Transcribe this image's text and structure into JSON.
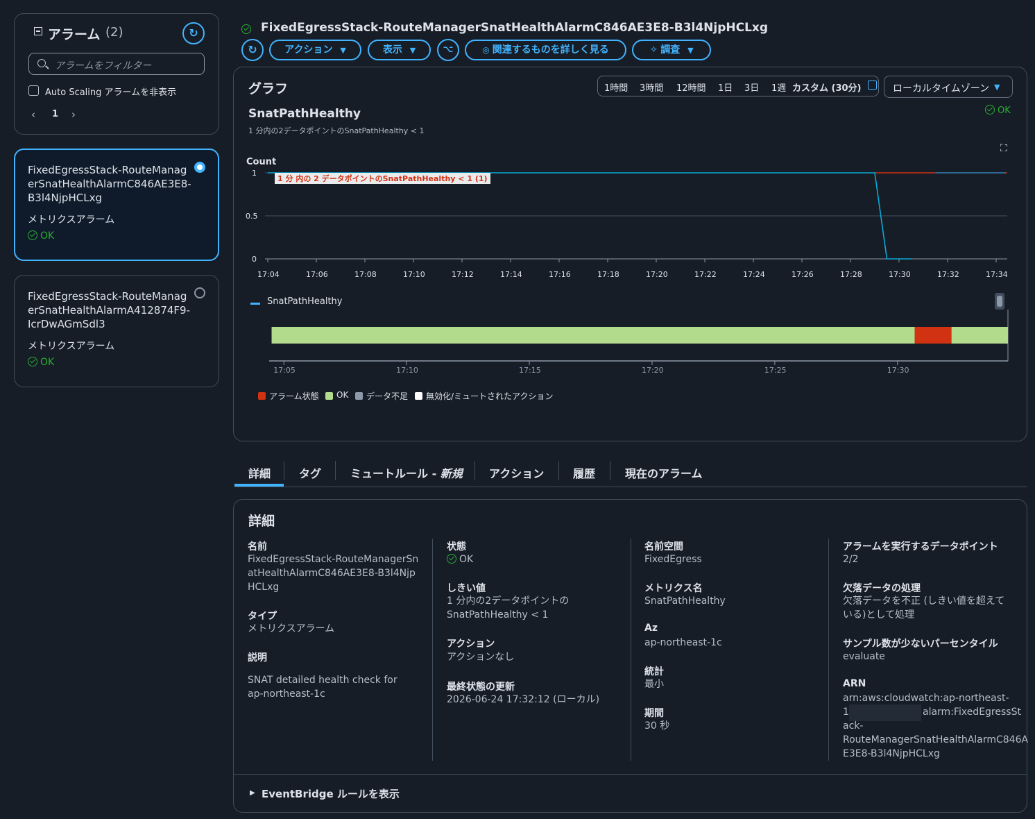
{
  "sidebar": {
    "title": "アラーム",
    "count": "(2)",
    "filter_placeholder": "アラームをフィルター",
    "hide_autoscaling_label": "Auto Scaling アラームを非表示",
    "page": "1",
    "alarms": [
      {
        "name": "FixedEgressStack-RouteManagerSnatHealthAlarmC846AE3E8-B3l4NjpHCLxg",
        "type": "メトリクスアラーム",
        "status": "OK",
        "selected": true
      },
      {
        "name": "FixedEgressStack-RouteManagerSnatHealthAlarmA412874F9-IcrDwAGmSdl3",
        "type": "メトリクスアラーム",
        "status": "OK",
        "selected": false
      }
    ]
  },
  "header": {
    "alarm_title": "FixedEgressStack-RouteManagerSnatHealthAlarmC846AE3E8-B3l4NjpHCLxg",
    "actions_label": "アクション",
    "view_label": "表示",
    "related_label": "関連するものを詳しく見る",
    "investigate_label": "調査"
  },
  "graph": {
    "title": "グラフ",
    "ranges": [
      "1時間",
      "3時間",
      "12時間",
      "1日",
      "3日",
      "1週"
    ],
    "custom_range": "カスタム (30分)",
    "timezone": "ローカルタイムゾーン",
    "metric_title": "SnatPathHealthy",
    "condition": "1 分内の2データポイントのSnatPathHealthy < 1",
    "status": "OK",
    "y_axis_label": "Count",
    "threshold_annotation": "1 分 内の 2 データポイントのSnatPathHealthy < 1 (1)",
    "legend_series": "SnatPathHealthy",
    "timeline_legend": {
      "alarm": "アラーム状態",
      "ok": "OK",
      "insufficient": "データ不足",
      "disabled": "無効化/ミュートされたアクション"
    }
  },
  "chart_data": [
    {
      "type": "line",
      "ylabel": "Count",
      "ylim": [
        0,
        1
      ],
      "y_ticks": [
        "1",
        "0.5",
        "0"
      ],
      "x_ticks": [
        "17:04",
        "17:06",
        "17:08",
        "17:10",
        "17:12",
        "17:14",
        "17:16",
        "17:18",
        "17:20",
        "17:22",
        "17:24",
        "17:26",
        "17:28",
        "17:30",
        "17:32",
        "17:34"
      ],
      "threshold": 1,
      "series": [
        {
          "name": "SnatPathHealthy",
          "x": [
            "17:04",
            "17:29",
            "17:29.5",
            "17:30.5"
          ],
          "values": [
            1,
            1,
            0,
            0
          ]
        }
      ]
    },
    {
      "type": "area",
      "x_ticks": [
        "17:05",
        "17:10",
        "17:15",
        "17:20",
        "17:25",
        "17:30"
      ],
      "segments": [
        {
          "state": "OK",
          "start": "17:04.5",
          "end": "17:30.7"
        },
        {
          "state": "アラーム状態",
          "start": "17:30.7",
          "end": "17:32.2"
        },
        {
          "state": "OK",
          "start": "17:32.2",
          "end": "17:34.5"
        }
      ]
    }
  ],
  "tabs": [
    "詳細",
    "タグ",
    "ミュートルール - ",
    "アクション",
    "履歴",
    "現在のアラーム"
  ],
  "tab_new": "新規",
  "details": {
    "title": "詳細",
    "name_label": "名前",
    "name_value": "FixedEgressStack-RouteManagerSnatHealthAlarmC846AE3E8-B3l4NjpHCLxg",
    "type_label": "タイプ",
    "type_value": "メトリクスアラーム",
    "desc_label": "説明",
    "desc_value": "SNAT detailed health check for ap-northeast-1c",
    "state_label": "状態",
    "state_value": "OK",
    "threshold_label": "しきい値",
    "threshold_value": "1 分内の2データポイントの SnatPathHealthy < 1",
    "action_label": "アクション",
    "action_value": "アクションなし",
    "updated_label": "最終状態の更新",
    "updated_value": "2026-06-24 17:32:12 (ローカル)",
    "namespace_label": "名前空間",
    "namespace_value": "FixedEgress",
    "metric_label": "メトリクス名",
    "metric_value": "SnatPathHealthy",
    "az_label": "Az",
    "az_value": "ap-northeast-1c",
    "stat_label": "統計",
    "stat_value": "最小",
    "period_label": "期間",
    "period_value": "30 秒",
    "datapoints_label": "アラームを実行するデータポイント",
    "datapoints_value": "2/2",
    "missing_label": "欠落データの処理",
    "missing_value": "欠落データを不正 (しきい値を超えている)として処理",
    "percentile_label": "サンプル数が少ないパーセンタイル",
    "percentile_value": "evaluate",
    "arn_label": "ARN",
    "arn_line1": "arn:aws:cloudwatch:ap-northeast-",
    "arn_line2_a": "1",
    "arn_line2_b": "alarm:FixedEgressSt",
    "arn_line3": "ack-",
    "arn_line4": "RouteManagerSnatHealthAlarmC846A",
    "arn_line5": "E3E8-B3l4NjpHCLxg",
    "eventbridge_label": "EventBridge ルールを表示"
  }
}
